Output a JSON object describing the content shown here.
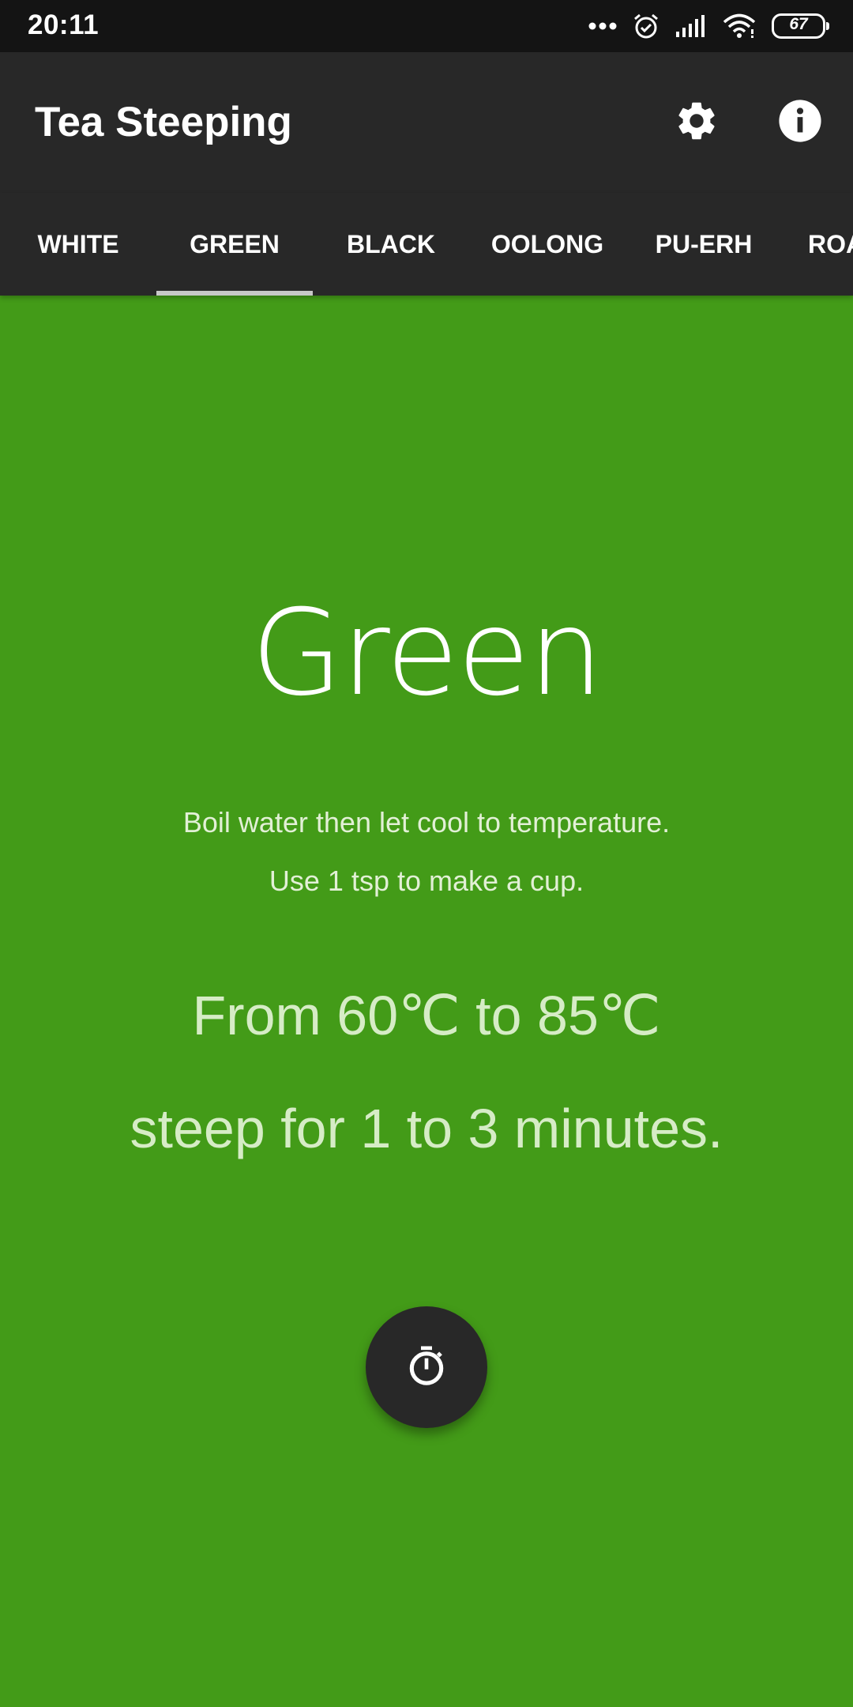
{
  "status_bar": {
    "time": "20:11",
    "battery_level": "67",
    "icons": [
      "more-dots-icon",
      "alarm-icon",
      "signal-icon",
      "wifi-icon",
      "battery-icon"
    ]
  },
  "app_bar": {
    "title": "Tea Steeping",
    "actions": [
      "settings-icon",
      "info-icon"
    ]
  },
  "tabs": {
    "items": [
      {
        "label": "WHITE"
      },
      {
        "label": "GREEN"
      },
      {
        "label": "BLACK"
      },
      {
        "label": "OOLONG"
      },
      {
        "label": "PU-ERH"
      },
      {
        "label": "ROA"
      }
    ],
    "selected": "GREEN"
  },
  "tea": {
    "name": "Green",
    "instruction_1": "Boil water then let cool to temperature.",
    "instruction_2": "Use 1 tsp to make a cup.",
    "temperature": "From 60℃ to 85℃",
    "steep_time": "steep for 1 to 3 minutes."
  },
  "fab": {
    "icon": "timer-icon"
  },
  "colors": {
    "background": "#439b18",
    "app_bar": "#282828",
    "status_bar": "#141414",
    "tab_indicator": "#c8c8c8"
  }
}
